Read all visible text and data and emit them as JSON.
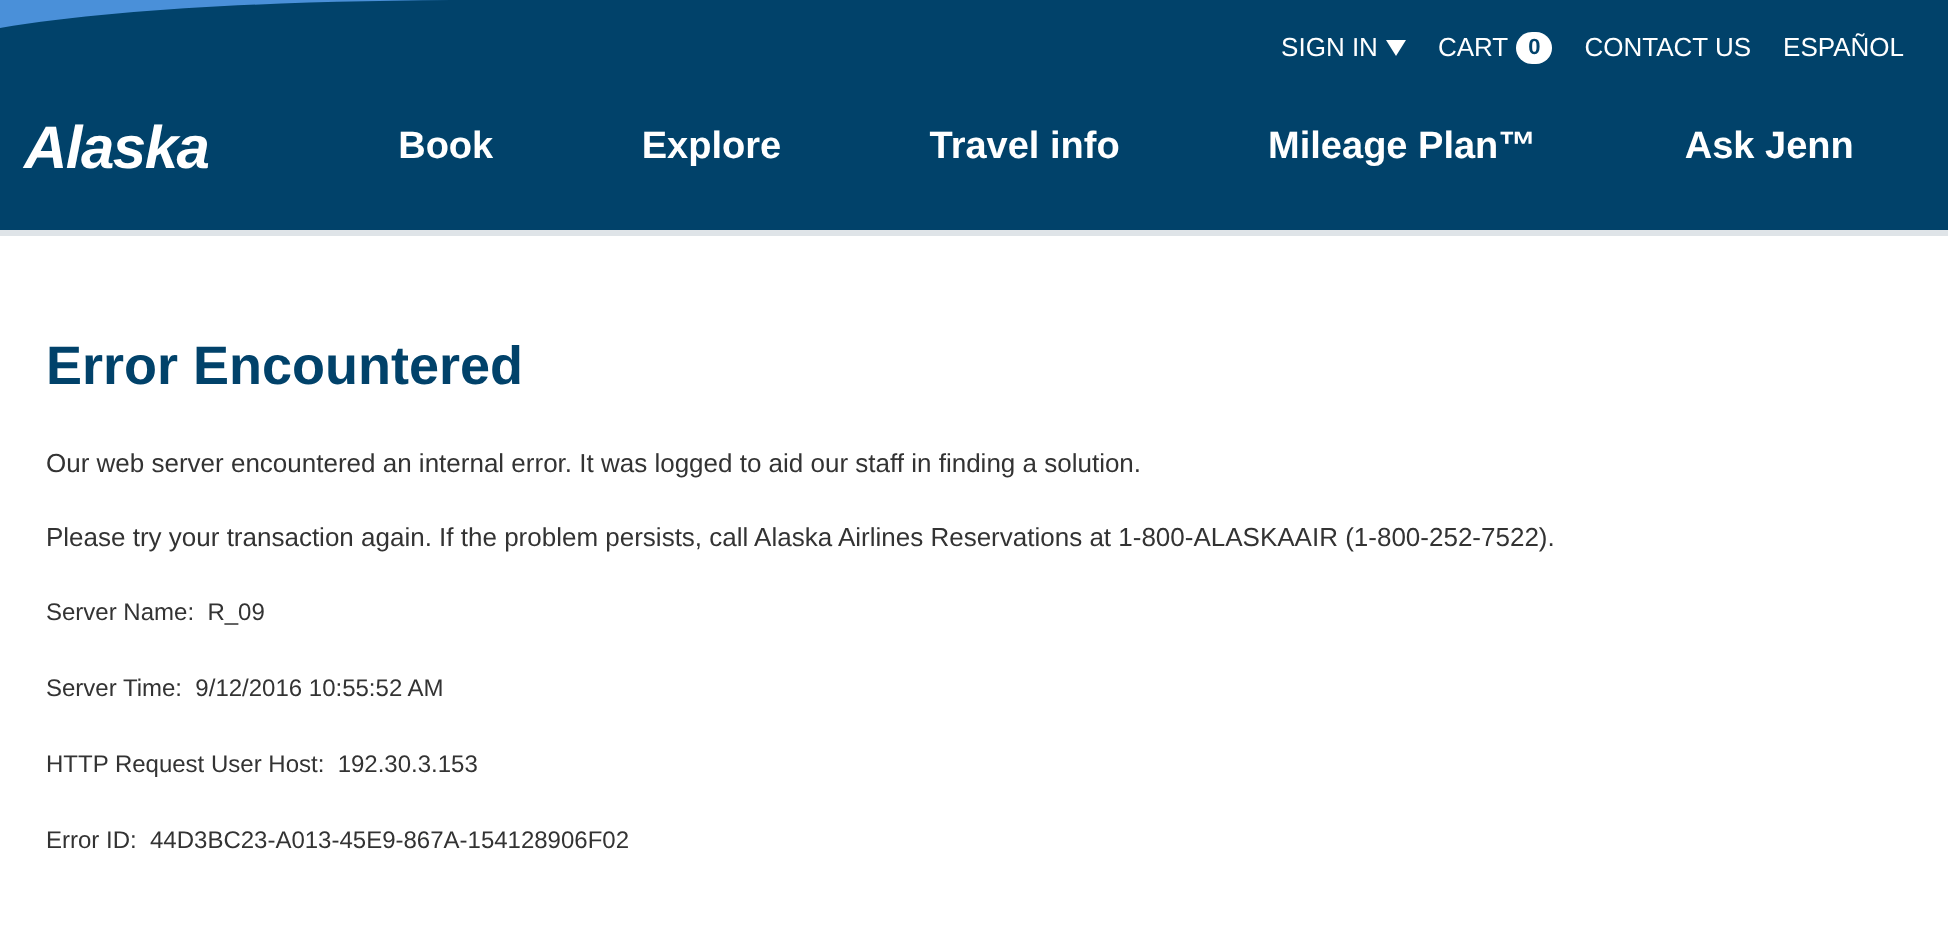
{
  "header": {
    "logo": "Alaska",
    "utility_links": [
      {
        "label": "SIGN IN",
        "kind": "dropdown"
      },
      {
        "label": "CART",
        "kind": "cart",
        "count": "0"
      },
      {
        "label": "CONTACT US",
        "kind": "link"
      },
      {
        "label": "ESPAÑOL",
        "kind": "link"
      }
    ],
    "nav": [
      "Book",
      "Explore",
      "Travel info",
      "Mileage Plan™",
      "Ask Jenn"
    ]
  },
  "content": {
    "title": "Error Encountered",
    "paragraphs": [
      "Our web server encountered an internal error. It was logged to aid our staff in finding a solution.",
      "Please try your transaction again. If the problem persists, call Alaska Airlines Reservations at 1-800-ALASKAAIR (1-800-252-7522)."
    ],
    "details": [
      "Server Name:  R_09",
      "Server Time:  9/12/2016 10:55:52 AM",
      "HTTP Request User Host:  192.30.3.153",
      "Error ID:  44D3BC23-A013-45E9-867A-154128906F02"
    ]
  }
}
